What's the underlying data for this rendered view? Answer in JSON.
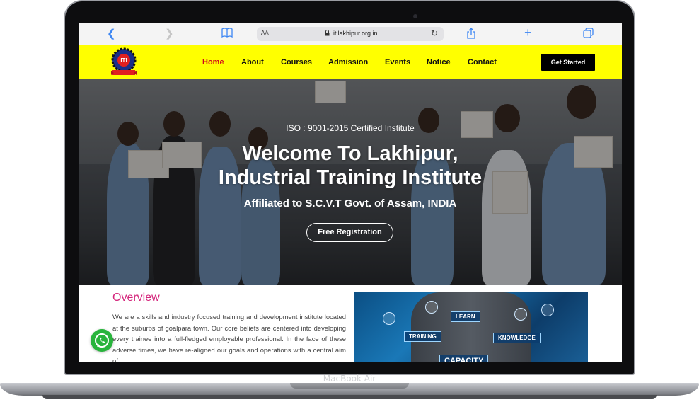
{
  "device": {
    "label": "MacBook Air"
  },
  "browser": {
    "text_size_label": "AA",
    "url": "itilakhipur.org.in",
    "icons": [
      "back-icon",
      "forward-icon",
      "bookmarks-icon",
      "lock-icon",
      "reload-icon",
      "share-icon",
      "new-tab-icon",
      "tabs-icon"
    ]
  },
  "nav": {
    "items": [
      {
        "label": "Home"
      },
      {
        "label": "About"
      },
      {
        "label": "Courses"
      },
      {
        "label": "Admission"
      },
      {
        "label": "Events"
      },
      {
        "label": "Notice"
      },
      {
        "label": "Contact"
      }
    ],
    "cta": "Get Started",
    "logo_text": "ITI",
    "active_color": "#d0021b",
    "bar_color": "#ffff00"
  },
  "hero": {
    "iso": "ISO : 9001-2015 Certified Institute",
    "title_line1": "Welcome To Lakhipur,",
    "title_line2": "Industrial Training Institute",
    "subtitle": "Affiliated to S.C.V.T Govt. of Assam, INDIA",
    "button": "Free Registration"
  },
  "overview": {
    "title": "Overview",
    "text": "We are a skills and industry focused training and development institute located at the suburbs of goalpara town. Our core beliefs are centered into developing every trainee into a full-fledged employable professional. In the face of these adverse times, we have re-aligned our goals and operations with a central aim of",
    "image_tags": {
      "learn": "LEARN",
      "training": "TRAINING",
      "knowledge": "KNOWLEDGE",
      "capacity": "CAPACITY"
    },
    "title_color": "#d4237a"
  },
  "floating": {
    "whatsapp_color": "#28b43c"
  }
}
